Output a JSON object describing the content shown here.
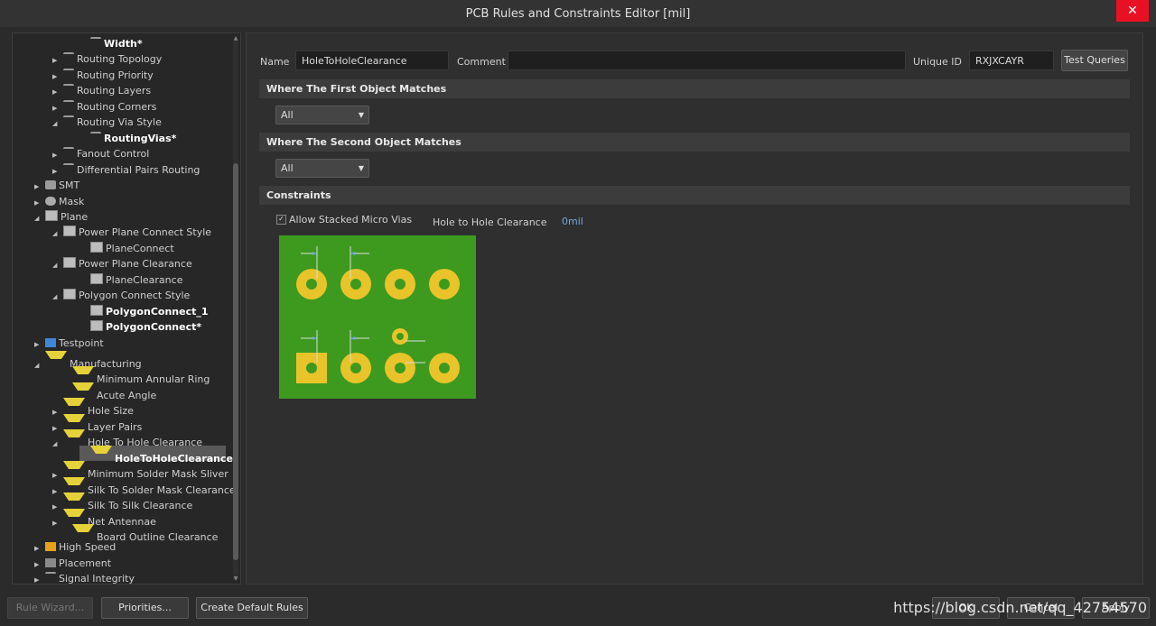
{
  "window": {
    "title": "PCB Rules and Constraints Editor [mil]",
    "close_glyph": "✕"
  },
  "tree": [
    {
      "label": "Width*",
      "bold": true,
      "icon": "route",
      "arrow": ""
    },
    {
      "label": "Routing Topology",
      "icon": "route",
      "arrow": "▶"
    },
    {
      "label": "Routing Priority",
      "icon": "route",
      "arrow": "▶"
    },
    {
      "label": "Routing Layers",
      "icon": "route",
      "arrow": "▶"
    },
    {
      "label": "Routing Corners",
      "icon": "route",
      "arrow": "▶"
    },
    {
      "label": "Routing Via Style",
      "icon": "route",
      "arrow": "◢"
    },
    {
      "label": "RoutingVias*",
      "bold": true,
      "icon": "route",
      "arrow": ""
    },
    {
      "label": "Fanout Control",
      "icon": "route",
      "arrow": "▶"
    },
    {
      "label": "Differential Pairs Routing",
      "icon": "route",
      "arrow": "▶"
    },
    {
      "label": "SMT",
      "icon": "smt",
      "arrow": "▶"
    },
    {
      "label": "Mask",
      "icon": "mask",
      "arrow": "▶"
    },
    {
      "label": "Plane",
      "icon": "grid",
      "arrow": "◢"
    },
    {
      "label": "Power Plane Connect Style",
      "icon": "grid",
      "arrow": "◢"
    },
    {
      "label": "PlaneConnect",
      "icon": "grid",
      "arrow": ""
    },
    {
      "label": "Power Plane Clearance",
      "icon": "grid",
      "arrow": "◢"
    },
    {
      "label": "PlaneClearance",
      "icon": "grid",
      "arrow": ""
    },
    {
      "label": "Polygon Connect Style",
      "icon": "grid",
      "arrow": "◢"
    },
    {
      "label": "PolygonConnect_1",
      "bold": true,
      "icon": "grid",
      "arrow": ""
    },
    {
      "label": "PolygonConnect*",
      "bold": true,
      "icon": "grid",
      "arrow": ""
    },
    {
      "label": "Testpoint",
      "icon": "test",
      "arrow": "▶"
    },
    {
      "label": "Manufacturing",
      "icon": "mfg",
      "arrow": "◢"
    },
    {
      "label": "Minimum Annular Ring",
      "icon": "mfg",
      "arrow": ""
    },
    {
      "label": "Acute Angle",
      "icon": "mfg",
      "arrow": ""
    },
    {
      "label": "Hole Size",
      "icon": "mfg",
      "arrow": "▶"
    },
    {
      "label": "Layer Pairs",
      "icon": "mfg",
      "arrow": "▶"
    },
    {
      "label": "Hole To Hole Clearance",
      "icon": "mfg",
      "arrow": "◢"
    },
    {
      "label": "HoleToHoleClearance*",
      "bold": true,
      "selected": true,
      "icon": "mfg",
      "arrow": ""
    },
    {
      "label": "Minimum Solder Mask Sliver",
      "icon": "mfg",
      "arrow": "▶"
    },
    {
      "label": "Silk To Solder Mask Clearance",
      "icon": "mfg",
      "arrow": "▶"
    },
    {
      "label": "Silk To Silk Clearance",
      "icon": "mfg",
      "arrow": "▶"
    },
    {
      "label": "Net Antennae",
      "icon": "mfg",
      "arrow": "▶"
    },
    {
      "label": "Board Outline Clearance",
      "icon": "mfg",
      "arrow": ""
    },
    {
      "label": "High Speed",
      "icon": "hs",
      "arrow": "▶"
    },
    {
      "label": "Placement",
      "icon": "place",
      "arrow": "▶"
    },
    {
      "label": "Signal Integrity",
      "icon": "route",
      "arrow": "▶"
    }
  ],
  "form": {
    "name_label": "Name",
    "name_value": "HoleToHoleClearance",
    "comment_label": "Comment",
    "comment_value": "",
    "uid_label": "Unique ID",
    "uid_value": "RXJXCAYR",
    "test_queries": "Test Queries"
  },
  "sections": {
    "first": "Where The First Object Matches",
    "second": "Where The Second Object Matches",
    "constraints": "Constraints"
  },
  "first_match": "All",
  "second_match": "All",
  "constraints": {
    "allow_stacked_label": "Allow Stacked Micro Vias",
    "allow_stacked_checked": "✓",
    "h2h_label": "Hole to Hole Clearance",
    "h2h_value": "0mil"
  },
  "buttons": {
    "rule_wizard": "Rule Wizard...",
    "priorities": "Priorities...",
    "create_default": "Create Default Rules",
    "ok": "OK",
    "cancel": "Cancel",
    "apply": "Apply"
  },
  "watermark": "https://blog.csdn.net/qq_42754570",
  "colors": {
    "board": "#3d9a1f",
    "pad": "#e8c42a",
    "hole": "#3d9a1f"
  }
}
